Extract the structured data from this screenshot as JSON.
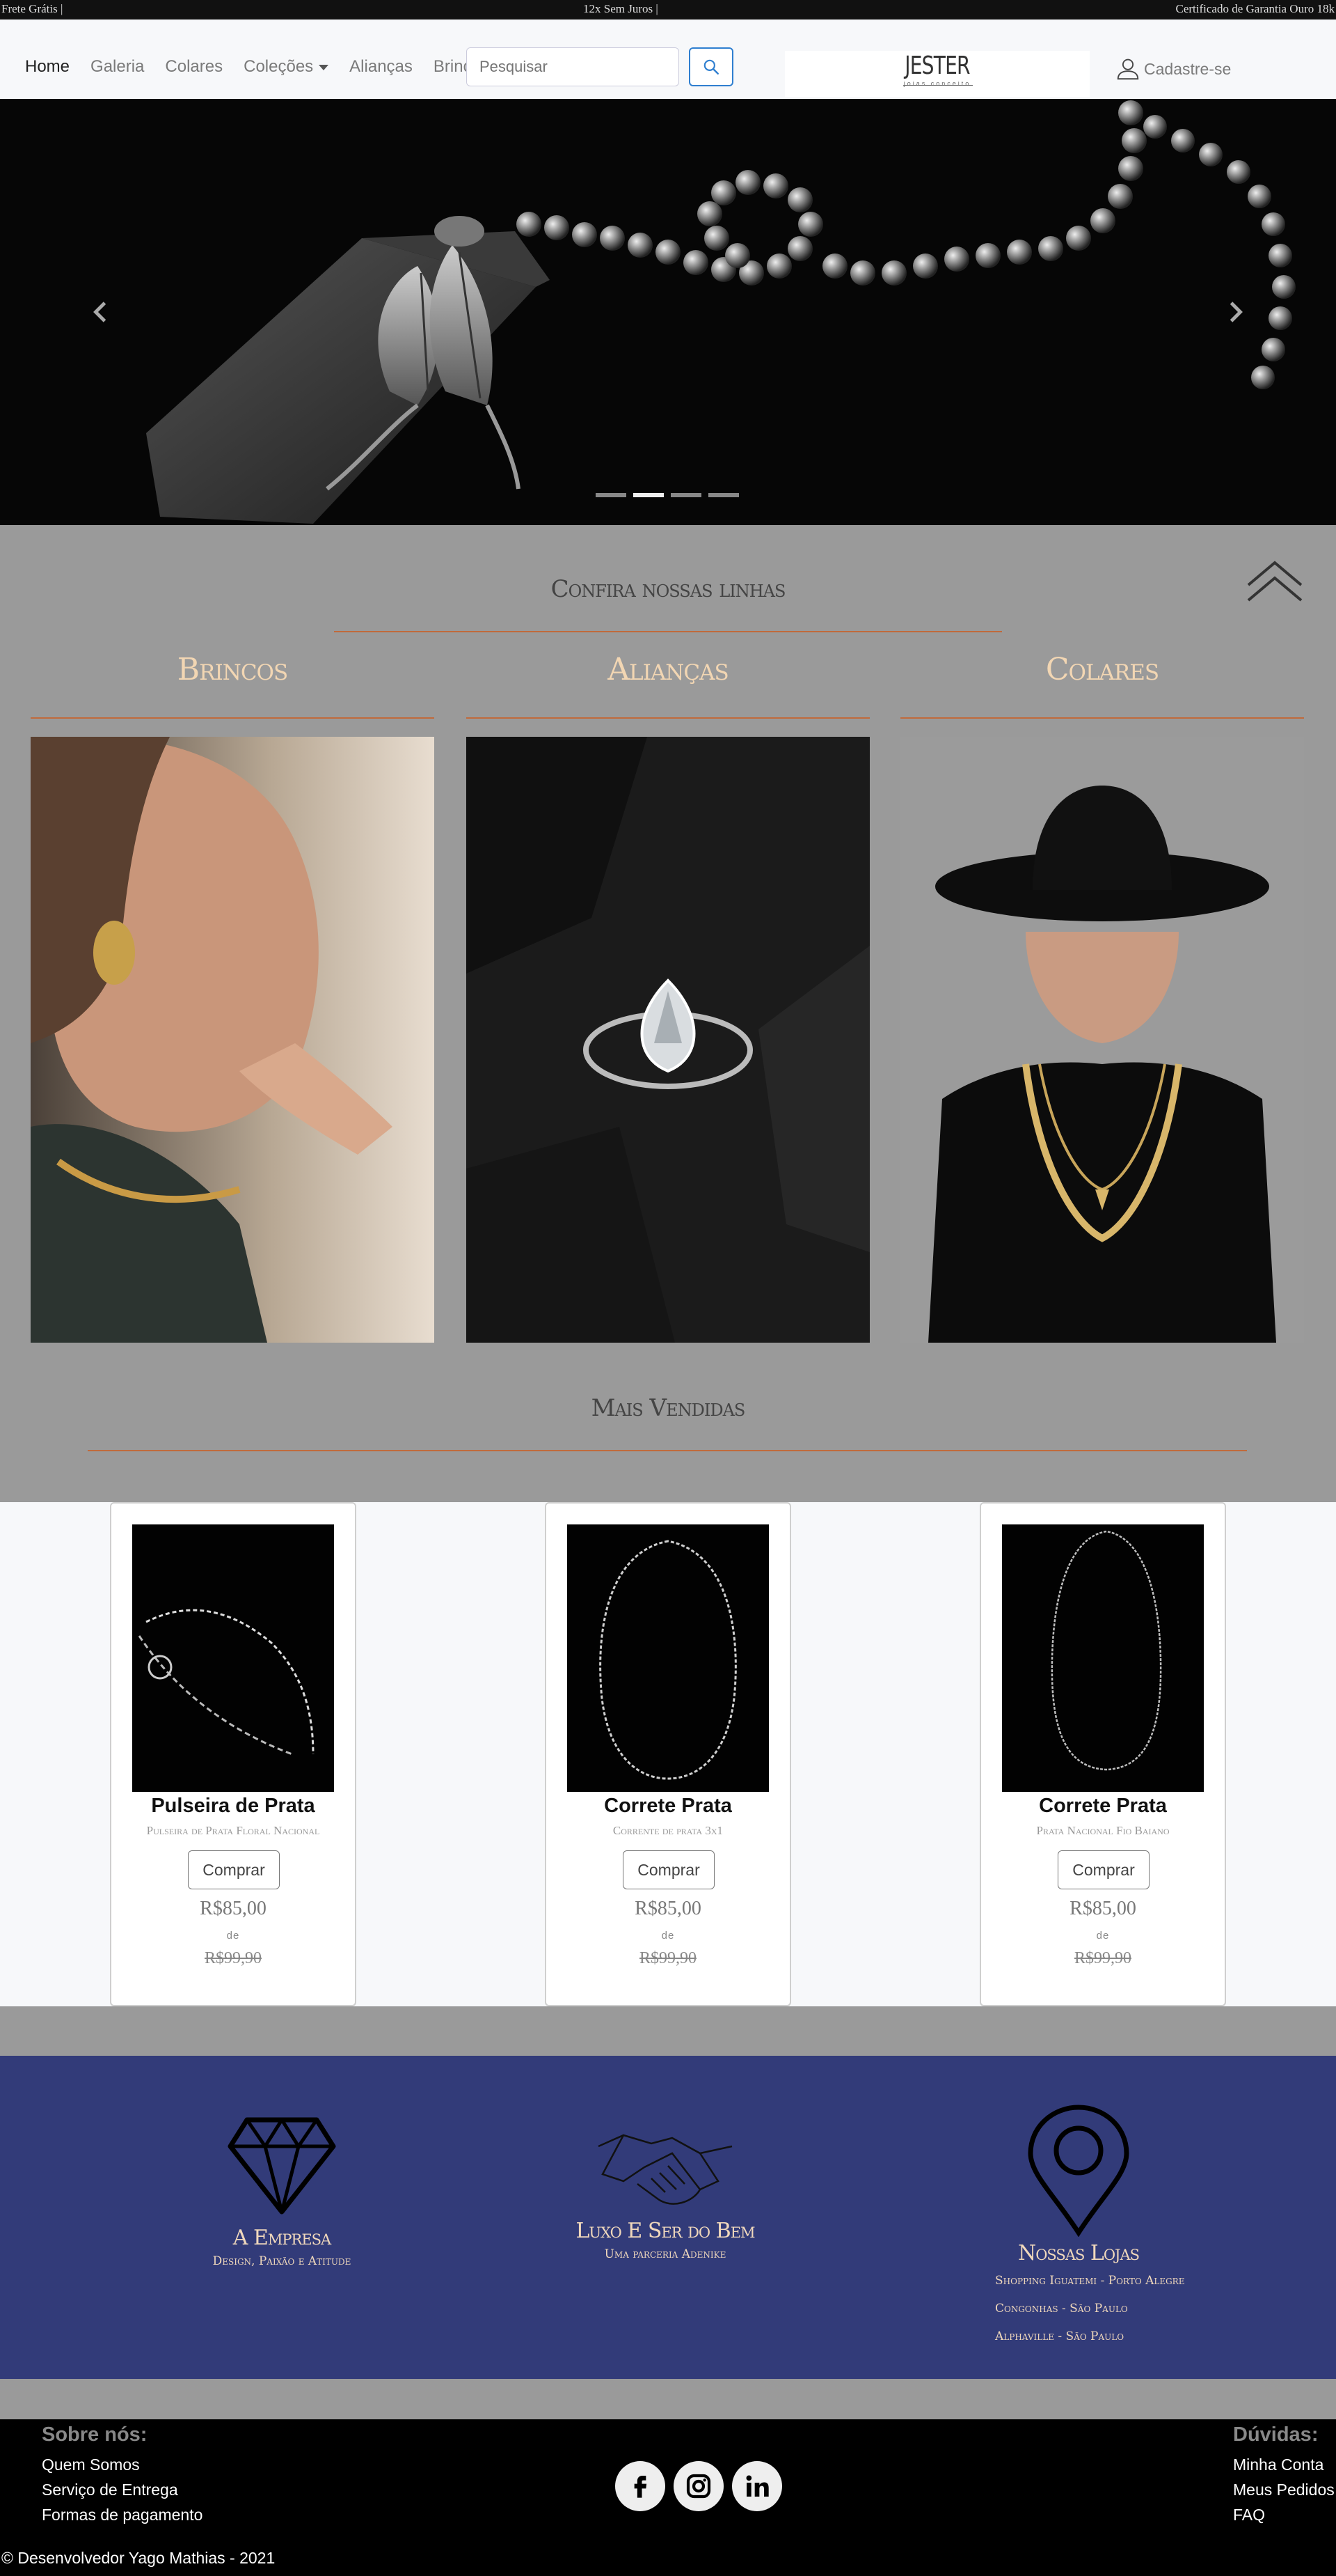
{
  "topbar": {
    "left": "Frete Grátis |",
    "center": "12x Sem Juros |",
    "right": "Certificado de Garantia Ouro 18k"
  },
  "nav": {
    "items": [
      "Home",
      "Galeria",
      "Colares",
      "Coleções",
      "Alianças",
      "Brincos"
    ],
    "active": "Home"
  },
  "search": {
    "placeholder": "Pesquisar",
    "value": "Pesquisar"
  },
  "logo": {
    "name": "JESTER",
    "tagline": "joias conceito"
  },
  "signup": {
    "label": "Cadastre-se",
    "icon": "user-icon"
  },
  "carousel": {
    "slides": 4,
    "active_slide": 2
  },
  "lines": {
    "title": "Confira nossas linhas",
    "categories": [
      {
        "title": "Brincos"
      },
      {
        "title": "Alianças"
      },
      {
        "title": "Colares"
      }
    ]
  },
  "bestsellers": {
    "title": "Mais Vendidas",
    "products": [
      {
        "name": "Pulseira de Prata",
        "desc": "Pulseira de Prata Floral Nacional",
        "buy": "Comprar",
        "price": "R$85,00",
        "from": "de",
        "old": "R$99,90"
      },
      {
        "name": "Correte Prata",
        "desc": "Corrente de prata 3x1",
        "buy": "Comprar",
        "price": "R$85,00",
        "from": "de",
        "old": "R$99,90"
      },
      {
        "name": "Correte Prata",
        "desc": "Prata Nacional Fio Baiano",
        "buy": "Comprar",
        "price": "R$85,00",
        "from": "de",
        "old": "R$99,90"
      }
    ]
  },
  "features": {
    "empresa": {
      "title": "A Empresa",
      "sub": "Design, Paixão e Atitude"
    },
    "luxo": {
      "title": "Luxo E Ser do Bem",
      "sub": "Uma parceria Adenike"
    },
    "lojas": {
      "title": "Nossas Lojas",
      "items": [
        "Shopping Iguatemi - Porto Alegre",
        "Congonhas - São Paulo",
        "Alphaville - São Paulo"
      ]
    }
  },
  "footer": {
    "about_title": "Sobre nós:",
    "about_links": [
      "Quem Somos",
      "Serviço de Entrega",
      "Formas de pagamento"
    ],
    "help_title": "Dúvidas:",
    "help_links": [
      "Minha Conta",
      "Meus Pedidos",
      "FAQ"
    ],
    "social": [
      "facebook-icon",
      "instagram-icon",
      "linkedin-icon"
    ],
    "copyright": "© Desenvolvedor Yago Mathias - 2021"
  },
  "colors": {
    "accent_rule": "#c06a3c",
    "feature_bg": "#323b79",
    "category_title": "#f2d6b3",
    "search_button": "#2f7fd0"
  }
}
